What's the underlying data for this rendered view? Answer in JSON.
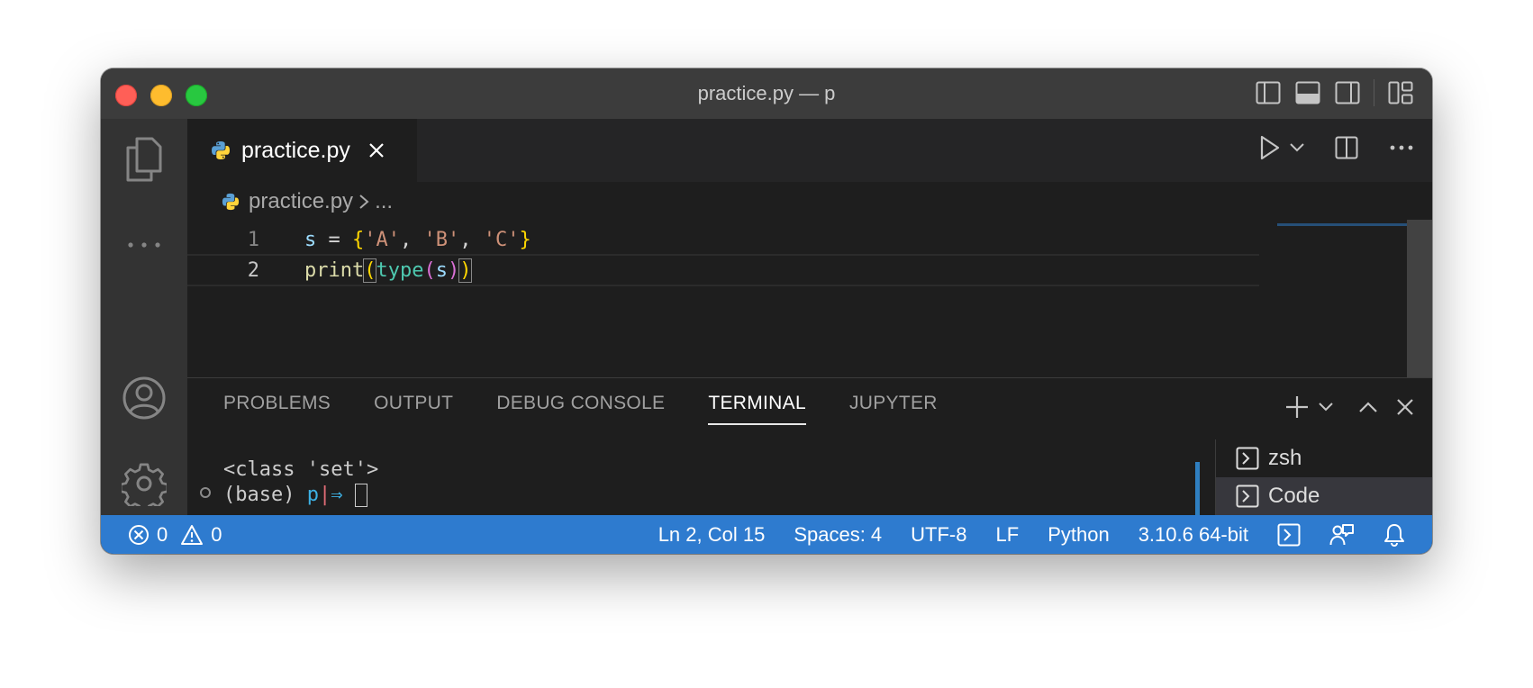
{
  "window": {
    "title": "practice.py — p"
  },
  "activity_bar": {
    "items": [
      {
        "icon": "files-icon"
      },
      {
        "icon": "more-icon"
      },
      {
        "icon": "account-icon"
      },
      {
        "icon": "gear-icon"
      }
    ]
  },
  "editor": {
    "tab": {
      "label": "practice.py",
      "icon": "python-icon"
    },
    "breadcrumbs": {
      "file": "practice.py",
      "more": "..."
    },
    "lines": [
      {
        "number": "1",
        "text": "s = {'A', 'B', 'C'}"
      },
      {
        "number": "2",
        "text": "print(type(s))"
      }
    ]
  },
  "panel": {
    "tabs": [
      "PROBLEMS",
      "OUTPUT",
      "DEBUG CONSOLE",
      "TERMINAL",
      "JUPYTER"
    ],
    "active_tab": "TERMINAL",
    "terminal": {
      "output_line": "<class 'set'>",
      "prompt_env": "(base)",
      "prompt_host": "p",
      "prompt_bar": "|",
      "prompt_arrow": "⇒"
    },
    "terminals": [
      {
        "label": "zsh"
      },
      {
        "label": "Code"
      }
    ]
  },
  "status_bar": {
    "errors": "0",
    "warnings": "0",
    "position": "Ln 2, Col 15",
    "spaces": "Spaces: 4",
    "encoding": "UTF-8",
    "eol": "LF",
    "language": "Python",
    "interpreter": "3.10.6 64-bit",
    "background_color": "#2e7bcf"
  },
  "colors": {
    "traffic_close": "#ff5f57",
    "traffic_minimize": "#febc2e",
    "traffic_maximize": "#28c840"
  }
}
